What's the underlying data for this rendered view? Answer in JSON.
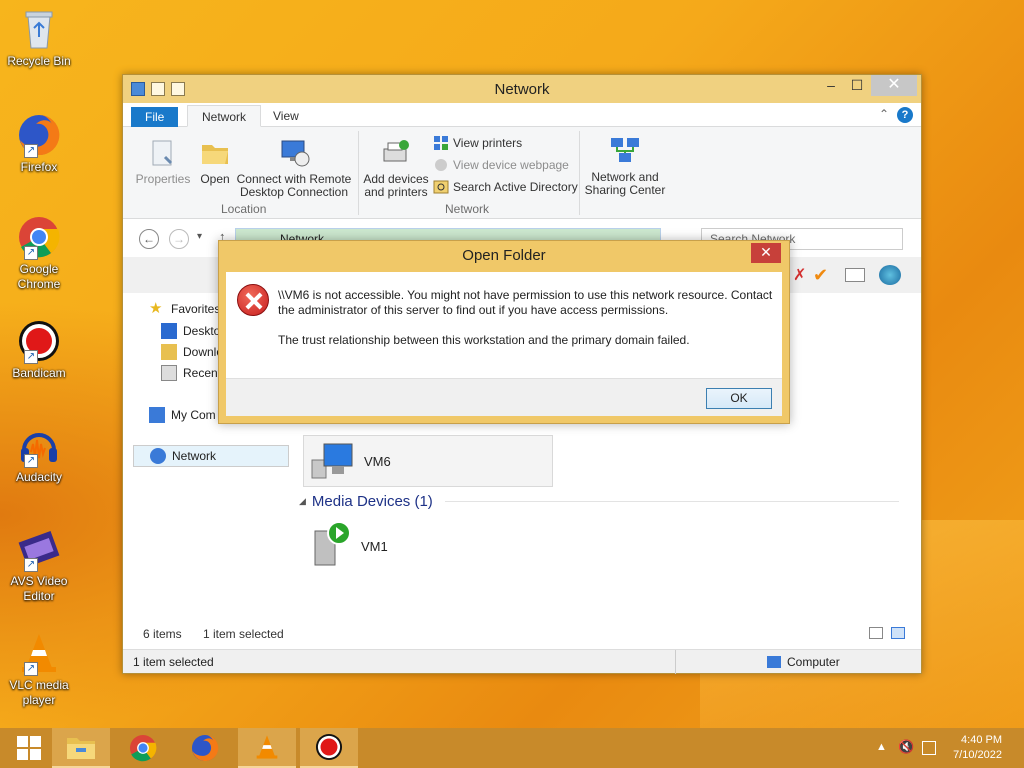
{
  "desktop": {
    "icons": [
      {
        "label": "Recycle Bin"
      },
      {
        "label": "Firefox"
      },
      {
        "label": "Google Chrome"
      },
      {
        "label": "Bandicam"
      },
      {
        "label": "Audacity"
      },
      {
        "label": "AVS Video Editor"
      },
      {
        "label": "VLC media player"
      }
    ]
  },
  "window": {
    "title": "Network",
    "tabs": {
      "file": "File",
      "network": "Network",
      "view": "View"
    },
    "ribbon": {
      "properties": "Properties",
      "open": "Open",
      "connect_rdp": "Connect with Remote Desktop Connection",
      "location_group": "Location",
      "add_devices": "Add devices and printers",
      "view_printers": "View printers",
      "view_device_webpage": "View device webpage",
      "search_ad": "Search Active Directory",
      "network_group": "Network",
      "network_sharing": "Network and Sharing Center"
    },
    "address": "Network",
    "search_placeholder": "Search Network",
    "nav": {
      "favorites": "Favorites",
      "desktop": "Deskto",
      "downloads": "Downlo",
      "recent": "Recent",
      "my_computer": "My Com",
      "network": "Network"
    },
    "content": {
      "vm6": "VM6",
      "group_title": "Media Devices (1)",
      "vm1": "VM1"
    },
    "status": {
      "items": "6 items",
      "selected": "1 item selected",
      "bottom_selected": "1 item selected",
      "zone": "Computer"
    }
  },
  "dialog": {
    "title": "Open Folder",
    "message": "\\\\VM6 is not accessible. You might not have permission to use this network resource. Contact the administrator of this server to find out if you have access permissions.",
    "detail": "The trust relationship between this workstation and the primary domain failed.",
    "ok": "OK"
  },
  "taskbar": {
    "time": "4:40 PM",
    "date": "7/10/2022"
  },
  "colors": {
    "accent": "#1979ca",
    "window_frame": "#f0d180",
    "dialog_frame": "#f0c868",
    "error_red": "#c81e1e"
  }
}
